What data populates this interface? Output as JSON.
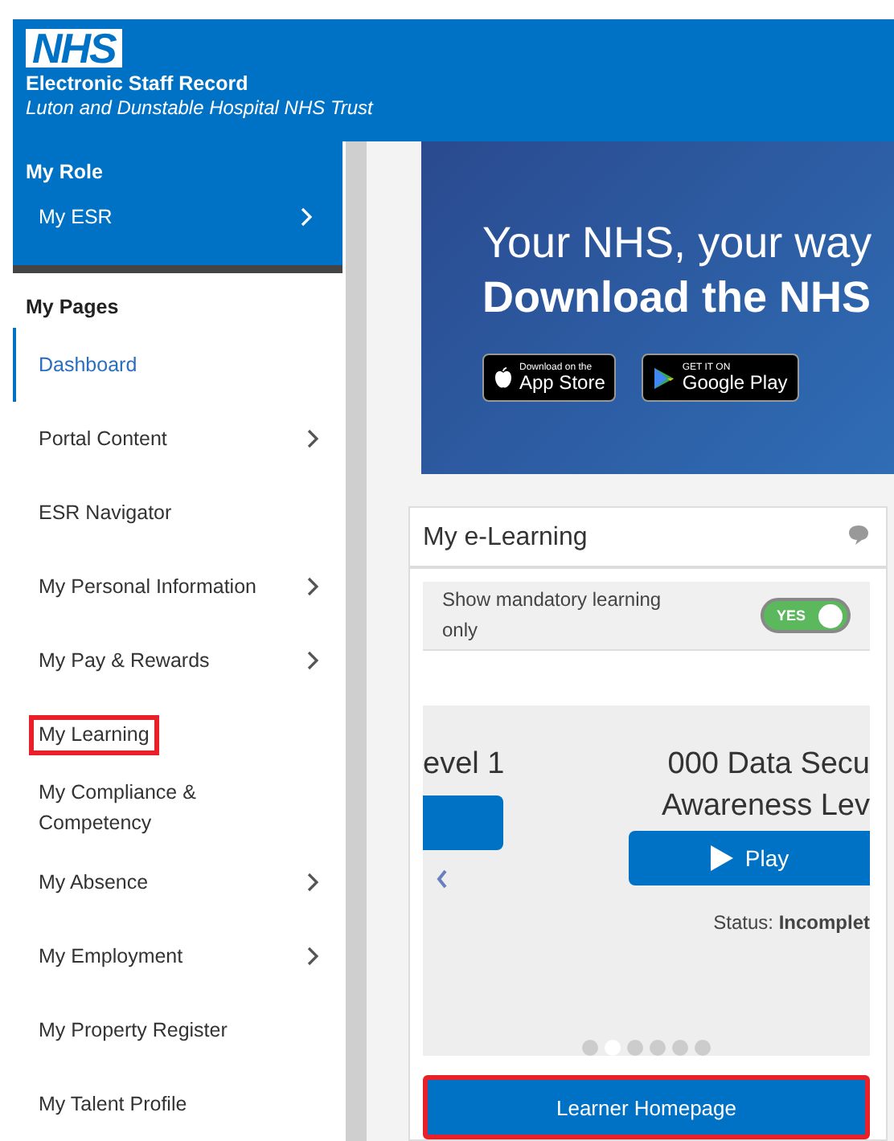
{
  "header": {
    "logo": "NHS",
    "title": "Electronic Staff Record",
    "subtitle": "Luton and Dunstable Hospital NHS Trust"
  },
  "sidebar": {
    "role_heading": "My Role",
    "role_items": [
      {
        "label": "My ESR",
        "has_submenu": true
      }
    ],
    "pages_heading": "My Pages",
    "items": [
      {
        "label": "Dashboard",
        "selected": true,
        "has_submenu": false,
        "highlighted": false
      },
      {
        "label": "Portal Content",
        "selected": false,
        "has_submenu": true,
        "highlighted": false
      },
      {
        "label": "ESR Navigator",
        "selected": false,
        "has_submenu": false,
        "highlighted": false
      },
      {
        "label": "My Personal Information",
        "selected": false,
        "has_submenu": true,
        "highlighted": false
      },
      {
        "label": "My Pay & Rewards",
        "selected": false,
        "has_submenu": true,
        "highlighted": false
      },
      {
        "label": "My Learning",
        "selected": false,
        "has_submenu": false,
        "highlighted": true
      },
      {
        "label": "My Compliance & Competency",
        "selected": false,
        "has_submenu": false,
        "highlighted": false
      },
      {
        "label": "My Absence",
        "selected": false,
        "has_submenu": true,
        "highlighted": false
      },
      {
        "label": "My Employment",
        "selected": false,
        "has_submenu": true,
        "highlighted": false
      },
      {
        "label": "My Property Register",
        "selected": false,
        "has_submenu": false,
        "highlighted": false
      },
      {
        "label": "My Talent Profile",
        "selected": false,
        "has_submenu": false,
        "highlighted": false
      }
    ]
  },
  "banner": {
    "line_1": "Your NHS, your way",
    "line_2": "Download the NHS",
    "badges": [
      {
        "kind": "apple",
        "small": "Download on the",
        "big": "App Store"
      },
      {
        "kind": "google",
        "small": "GET IT ON",
        "big": "Google Play"
      }
    ]
  },
  "elearning": {
    "title": "My e-Learning",
    "mandatory_toggle": {
      "label": "Show mandatory learning only",
      "on": true,
      "on_text": "YES"
    },
    "slides": [
      {
        "title_lines": [
          "evel 1"
        ]
      },
      {
        "title_lines": [
          "000 Data Secu",
          "Awareness Lev"
        ],
        "button": "Play",
        "status_label": "Status:",
        "status": "Incomplet"
      }
    ],
    "dots": [
      {
        "selected": false
      },
      {
        "selected": true
      },
      {
        "selected": false
      },
      {
        "selected": false
      },
      {
        "selected": false
      },
      {
        "selected": false
      }
    ],
    "homepage_button": {
      "label": "Learner Homepage",
      "highlighted": true
    }
  }
}
